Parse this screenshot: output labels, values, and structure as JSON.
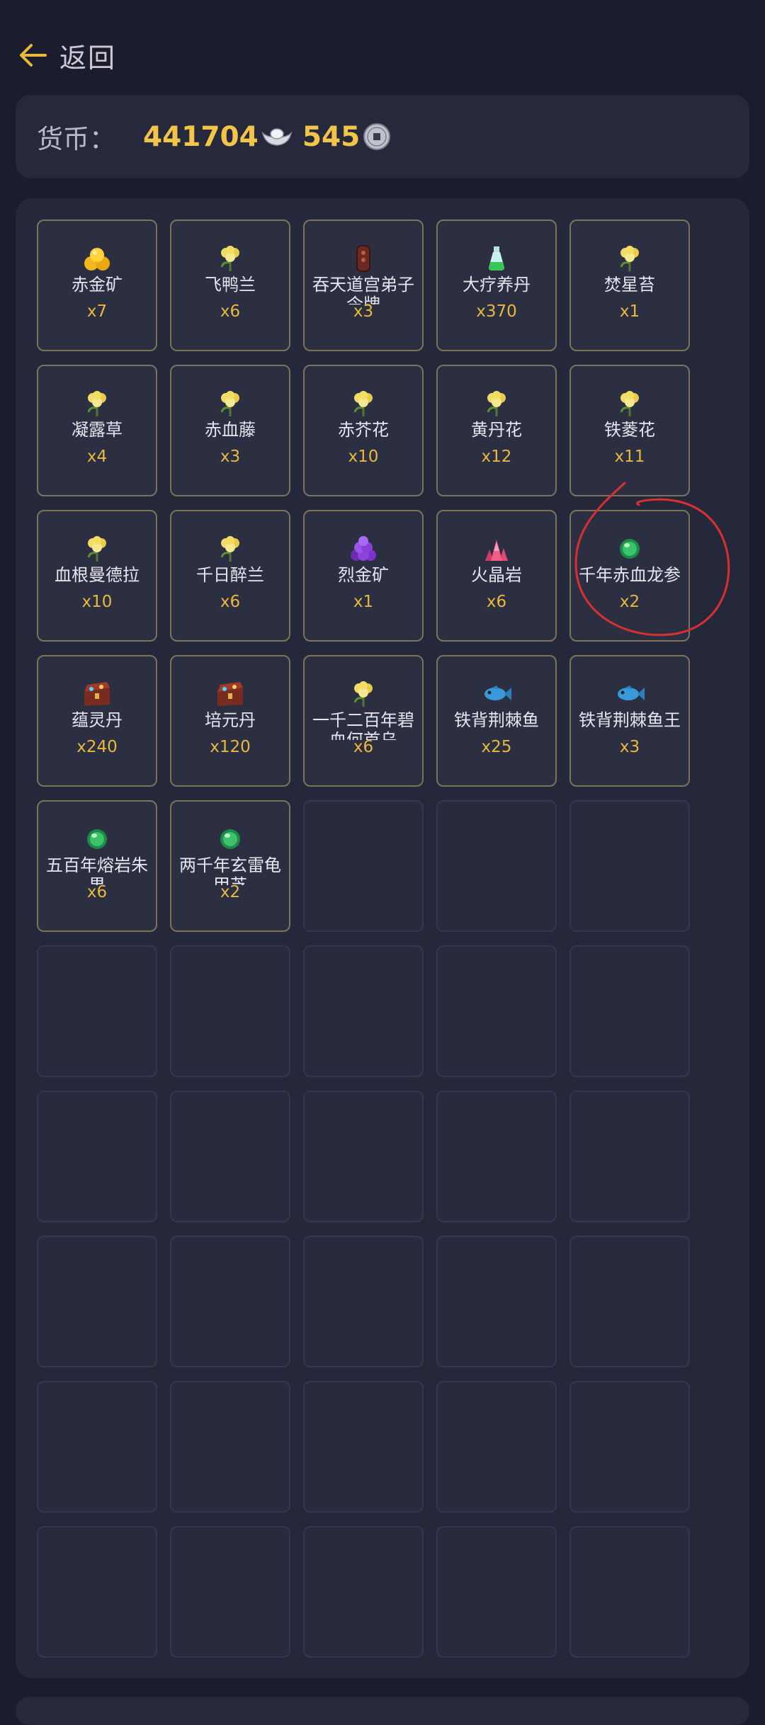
{
  "header": {
    "back_label": "返回"
  },
  "currency": {
    "label": "货币：",
    "silver": "441704",
    "coins": "545",
    "silver_icon": "silver-ingot-icon",
    "coin_icon": "copper-coin-icon"
  },
  "items": [
    {
      "name": "赤金矿",
      "qty": "x7",
      "icon": "gold-ore-icon"
    },
    {
      "name": "飞鸭兰",
      "qty": "x6",
      "icon": "herb-icon"
    },
    {
      "name": "吞天道宫弟子令牌",
      "qty": "x3",
      "icon": "token-icon"
    },
    {
      "name": "大疗养丹",
      "qty": "x370",
      "icon": "potion-icon"
    },
    {
      "name": "焚星苔",
      "qty": "x1",
      "icon": "herb-icon"
    },
    {
      "name": "凝露草",
      "qty": "x4",
      "icon": "herb-icon"
    },
    {
      "name": "赤血藤",
      "qty": "x3",
      "icon": "herb-icon"
    },
    {
      "name": "赤芥花",
      "qty": "x10",
      "icon": "herb-icon"
    },
    {
      "name": "黄丹花",
      "qty": "x12",
      "icon": "herb-icon"
    },
    {
      "name": "铁菱花",
      "qty": "x11",
      "icon": "herb-icon"
    },
    {
      "name": "血根曼德拉",
      "qty": "x10",
      "icon": "herb-icon"
    },
    {
      "name": "千日醉兰",
      "qty": "x6",
      "icon": "herb-icon"
    },
    {
      "name": "烈金矿",
      "qty": "x1",
      "icon": "purple-ore-icon"
    },
    {
      "name": "火晶岩",
      "qty": "x6",
      "icon": "red-crystal-icon"
    },
    {
      "name": "千年赤血龙参",
      "qty": "x2",
      "icon": "green-gem-icon"
    },
    {
      "name": "蕴灵丹",
      "qty": "x240",
      "icon": "treasure-chest-icon"
    },
    {
      "name": "培元丹",
      "qty": "x120",
      "icon": "treasure-chest-icon"
    },
    {
      "name": "一千二百年碧血何首乌",
      "qty": "x6",
      "icon": "herb-icon"
    },
    {
      "name": "铁背荆棘鱼",
      "qty": "x25",
      "icon": "fish-icon"
    },
    {
      "name": "铁背荆棘鱼王",
      "qty": "x3",
      "icon": "fish-icon"
    },
    {
      "name": "五百年熔岩朱果",
      "qty": "x6",
      "icon": "green-gem-icon"
    },
    {
      "name": "两千年玄雷龟甲芝",
      "qty": "x2",
      "icon": "green-gem-icon"
    }
  ],
  "empty_slots": 28,
  "colors": {
    "background": "#1b1d2e",
    "panel": "#25283b",
    "accent_gold": "#f2c449",
    "quantity": "#e8b93c",
    "filled_border": "#7b7458",
    "annotation": "#d9302f"
  }
}
